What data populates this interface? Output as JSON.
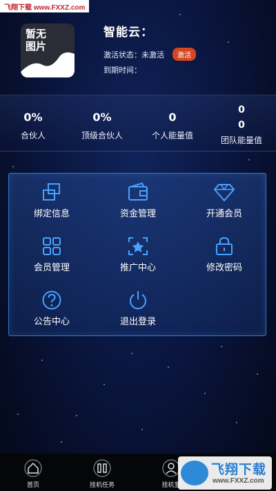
{
  "watermark_top": "飞翔下载 www.FXXZ.com",
  "profile": {
    "avatar_text": "暂无图片",
    "app_title": "智能云：",
    "status_label": "激活状态：未激活",
    "activate_button": "激活",
    "expire_label": "到期时间："
  },
  "stats": [
    {
      "value": "0%",
      "label": "合伙人"
    },
    {
      "value": "0%",
      "label": "顶级合伙人"
    },
    {
      "value": "0",
      "label": "个人能量值"
    },
    {
      "value": "0",
      "value2": "0",
      "label": "团队能量值"
    }
  ],
  "menu": [
    {
      "label": "绑定信息",
      "icon": "bind-icon"
    },
    {
      "label": "资金管理",
      "icon": "wallet-icon"
    },
    {
      "label": "开通会员",
      "icon": "diamond-icon"
    },
    {
      "label": "会员管理",
      "icon": "grid-icon"
    },
    {
      "label": "推广中心",
      "icon": "star-frame-icon"
    },
    {
      "label": "修改密码",
      "icon": "lock-icon"
    },
    {
      "label": "公告中心",
      "icon": "question-icon"
    },
    {
      "label": "退出登录",
      "icon": "power-icon"
    }
  ],
  "bottom_nav": [
    {
      "label": "首页",
      "icon": "home-icon"
    },
    {
      "label": "挂机任务",
      "icon": "task-icon"
    },
    {
      "label": "挂机室",
      "icon": "user-icon"
    }
  ],
  "watermark_bottom": {
    "brand": "飞翔下载",
    "url": "www.FXXZ.com"
  },
  "colors": {
    "accent_border": "#2f78c8",
    "activate_bg": "#d4461f",
    "icon_blue": "#4aa3ff"
  }
}
